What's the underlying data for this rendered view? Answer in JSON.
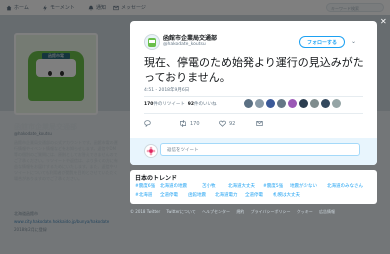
{
  "nav": {
    "home": "ホーム",
    "moments": "モーメント",
    "notifications": "通知",
    "messages": "メッセージ",
    "search_placeholder": "キーワード検索"
  },
  "profile": {
    "name": "函館市企業局交通部",
    "handle": "@hakodate_koutsu",
    "sign": "函館市電",
    "bio": "函館市企業局交通部の公式アカウントです。函館市電の運行情報やイベント情報などをお知らせします。返信やDM等の個別のご質問には、原則としてお答えできませんのでご了承ください。リツイートや返信は、より多くの方に有益な情報をお届けするためにいたします。また、返信やリツイートについても利用者が閲覧を目的とさせていただく場合がありますのでご了承ください。",
    "location": "北海道函館市",
    "link": "www.city.hakodate.hokkaido.jp/bunya/hakodate",
    "joined": "2018年2月に登録"
  },
  "tweet": {
    "author_name": "函館市企業局交通部",
    "author_handle": "@hakodate_koutsu",
    "follow_label": "フォローする",
    "text": "現在、停電のため始発より運行の見込みがたっておりません。",
    "timestamp": "4:51 - 2018年9月6日",
    "retweets_count": "170",
    "retweets_label": "件のリツイート",
    "likes_count": "92",
    "likes_label": "件のいいね",
    "reply_count": "",
    "retweet_action_count": "170",
    "like_action_count": "92",
    "reply_placeholder": "返信をツイート"
  },
  "trends": {
    "title": "日本のトレンド",
    "items": [
      "#震度6強",
      "北海道の地震",
      "苫小牧",
      "北海道大丈夫",
      "#震度5強",
      "地震が少ない",
      "北海道のみなさん",
      "#北海道",
      "全道停電",
      "函館地震",
      "北海道電力",
      "全道停電",
      "札幌は大丈夫"
    ]
  },
  "footer": {
    "items": [
      "© 2018 Twitter",
      "Twitterについて",
      "ヘルプセンター",
      "規約",
      "プライバシーポリシー",
      "クッキー",
      "広告情報"
    ]
  },
  "colors": {
    "accent": "#1da1f2",
    "train_green": "#6abf4b"
  }
}
